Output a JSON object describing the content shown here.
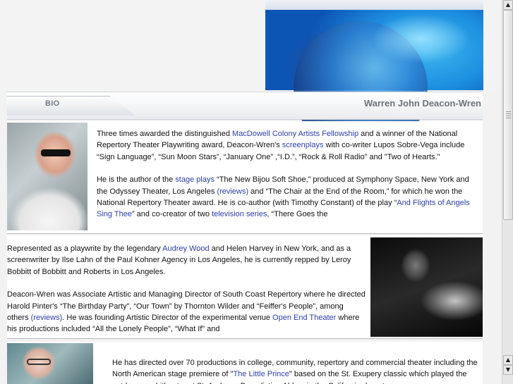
{
  "header": {
    "tab_label": "BIO",
    "title": "Warren John Deacon-Wren"
  },
  "sections": [
    {
      "paragraphs": [
        [
          {
            "t": "Three times awarded the distinguished "
          },
          {
            "t": "MacDowell Colony Artists Fellowship",
            "link": true
          },
          {
            "t": " and a winner of the National Repertory Theater Playwriting  award, Deacon-Wren's "
          },
          {
            "t": "screenplays",
            "link": true
          },
          {
            "t": " with co-writer Lupos Sobre-Vega include “Sign Language”, “Sun Moon Stars”, “January One” ,“I.D.”, “Rock & Roll Radio” and \"Two of Hearts.\""
          }
        ],
        [
          {
            "t": "He is the author of the "
          },
          {
            "t": "stage plays",
            "link": true
          },
          {
            "t": " “The New Bijou Soft Shoe,” produced at Symphony Space, New York and the Odyssey Theater, Los Angeles "
          },
          {
            "t": "(reviews)",
            "link": true
          },
          {
            "t": " and “The Chair at the End of the Room,” for which he won the National Repertory Theater award. He is co-author (with Timothy Constant) of the play “"
          },
          {
            "t": "And Flights of Angels Sing Thee",
            "link": true
          },
          {
            "t": "” and co-creator of two "
          },
          {
            "t": "television series",
            "link": true
          },
          {
            "t": ", “There Goes the"
          }
        ]
      ]
    },
    {
      "paragraphs": [
        [
          {
            "t": "Represented as a playwrite by the legendary "
          },
          {
            "t": "Audrey Wood",
            "link": true
          },
          {
            "t": " and Helen Harvey in New York, and as a screenwriter by Ilse Lahn of the Paul Kohner Agency in Los Angeles, he is currently repped by Leroy Bobbitt of Bobbitt and Roberts in Los Angeles."
          }
        ],
        [
          {
            "t": "Deacon-Wren was Associate Artistic and Managing Director of South Coast Repertory where he directed Harold Pinter's “The Birthday Party”, “Our Town” by Thornton Wilder and “Feiffer's People”, among others "
          },
          {
            "t": "(reviews)",
            "link": true
          },
          {
            "t": ".  He was founding Artistic Director of the experimental venue "
          },
          {
            "t": "Open End Theater",
            "link": true
          },
          {
            "t": " where his productions included “All the Lonely People”, “What If” and"
          }
        ]
      ]
    },
    {
      "paragraphs": [
        [
          {
            "t": "He has directed over 70 productions in college, community, repertory and commercial theater including the North American stage premiere of \""
          },
          {
            "t": "The Little Prince",
            "link": true
          },
          {
            "t": "\" based on the St. Exupery classic which played the outdoor amphitheatre at St. Andrews Benedictine Abbey in the California desert,"
          }
        ]
      ]
    }
  ],
  "colors": {
    "link": "#2b3fa8",
    "title": "#6e7378",
    "tab_label": "#6d7a86"
  },
  "icons": {
    "scroll_up": "arrow-up-icon",
    "scroll_down": "arrow-down-icon"
  }
}
